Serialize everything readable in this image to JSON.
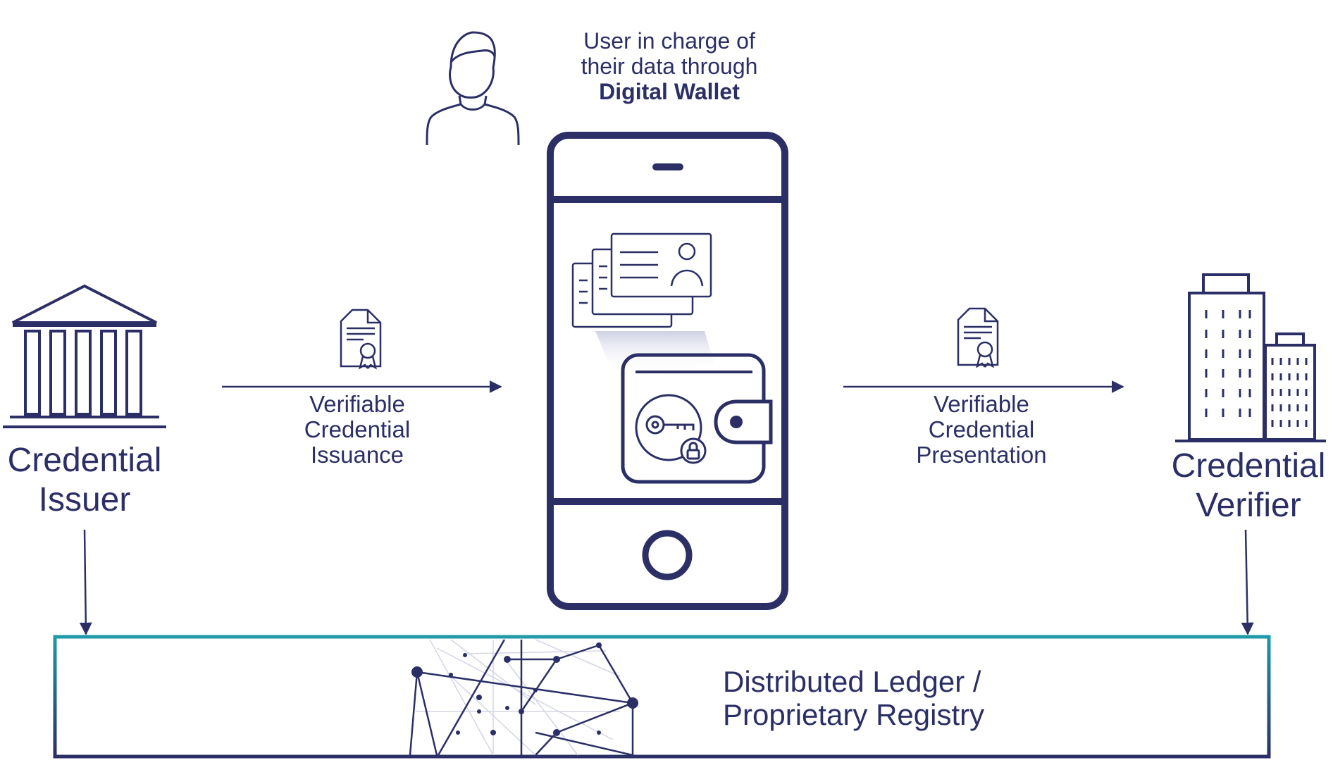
{
  "user": {
    "line1": "User in charge of",
    "line2": "their data through",
    "line3": "Digital Wallet"
  },
  "issuer": {
    "line1": "Credential",
    "line2": "Issuer"
  },
  "verifier": {
    "line1": "Credential",
    "line2": "Verifier"
  },
  "issuance": {
    "line1": "Verifiable",
    "line2": "Credential",
    "line3": "Issuance"
  },
  "presentation": {
    "line1": "Verifiable",
    "line2": "Credential",
    "line3": "Presentation"
  },
  "ledger": {
    "line1": "Distributed Ledger /",
    "line2": "Proprietary Registry"
  },
  "colors": {
    "navy": "#2b2f66",
    "teal": "#1e8fa0",
    "light": "#c9cbe0"
  },
  "icons": [
    "user-icon",
    "bank-building-icon",
    "office-buildings-icon",
    "certificate-icon",
    "smartphone-icon",
    "id-card-icon",
    "wallet-icon",
    "key-icon",
    "lock-icon",
    "network-graph-icon"
  ]
}
